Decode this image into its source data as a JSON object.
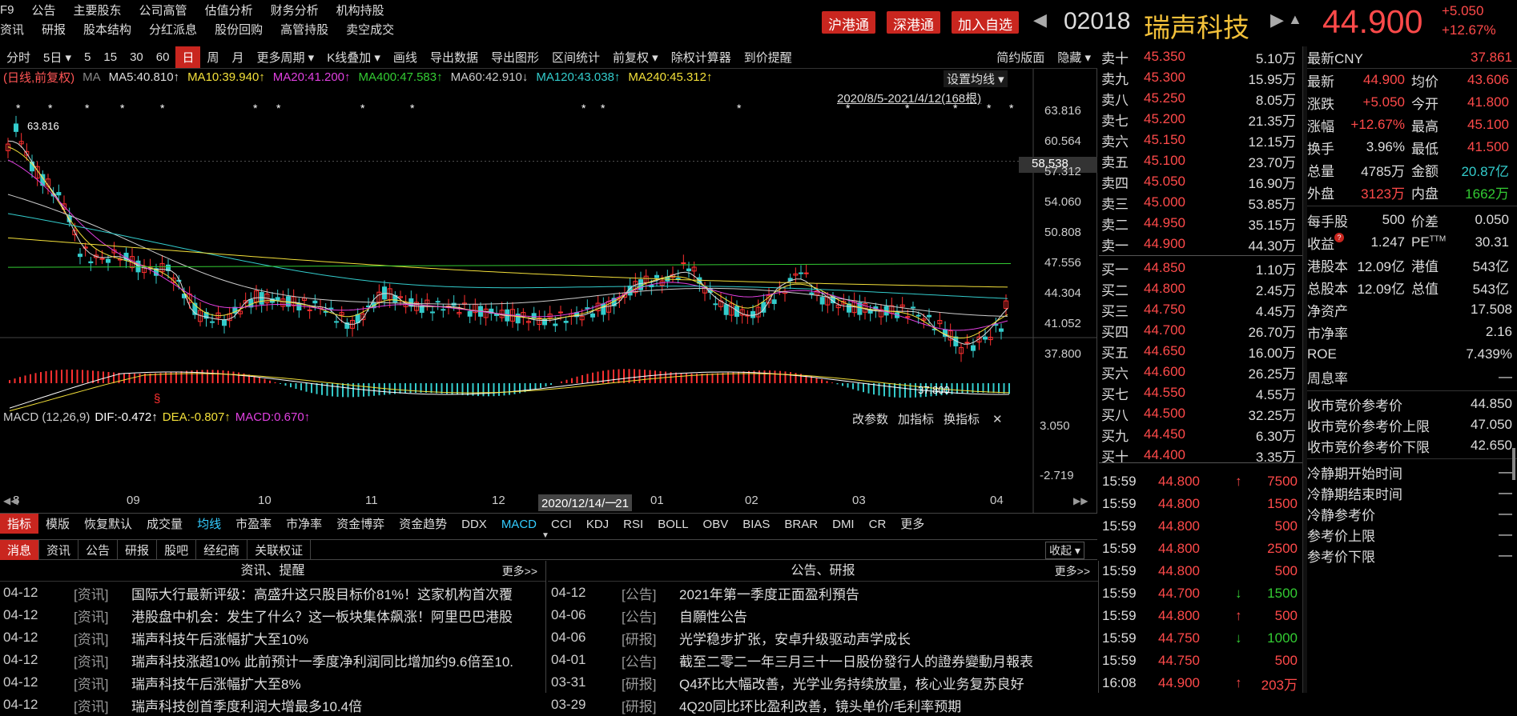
{
  "menu": {
    "row1": [
      "F9",
      "公告",
      "主要股东",
      "公司高管",
      "估值分析",
      "财务分析",
      "机构持股"
    ],
    "row2": [
      "资讯",
      "研报",
      "股本结构",
      "分红派息",
      "股份回购",
      "高管持股",
      "卖空成交"
    ]
  },
  "header": {
    "btn_hk_sh": "沪港通",
    "btn_hk_sz": "深港通",
    "btn_add": "加入自选",
    "code": "02018",
    "name": "瑞声科技",
    "price": "44.900",
    "change": "+5.050",
    "change_pct": "+12.67%"
  },
  "toolbar": {
    "items": [
      "分时",
      "5日 ▾",
      "5",
      "15",
      "30",
      "60",
      "日",
      "周",
      "月",
      "更多周期 ▾",
      "K线叠加 ▾",
      "画线",
      "导出数据",
      "导出图形",
      "区间统计",
      "前复权 ▾",
      "除权计算器",
      "到价提醒"
    ],
    "right": [
      "简约版面",
      "隐藏 ▾"
    ]
  },
  "ma_legend": [
    {
      "text": "(日线,前复权)",
      "color": "#ff5555"
    },
    {
      "text": "MA",
      "color": "#888888"
    },
    {
      "text": "MA5:40.810↑",
      "color": "#dddddd"
    },
    {
      "text": "MA10:39.940↑",
      "color": "#f3e03a"
    },
    {
      "text": "MA20:41.200↑",
      "color": "#e040e0"
    },
    {
      "text": "MA400:47.583↑",
      "color": "#33cc33"
    },
    {
      "text": "MA60:42.910↓",
      "color": "#cccccc"
    },
    {
      "text": "MA120:43.038↑",
      "color": "#33cccc"
    },
    {
      "text": "MA240:45.312↑",
      "color": "#f3e03a"
    }
  ],
  "chart_ctrl": {
    "set_ma": "设置均线 ▾",
    "range": "2020/8/5-2021/4/12(168根)",
    "high_lbl": "63.816",
    "low_lbl": "37.800",
    "cur_price_tag": "58.538",
    "s_mark": "§"
  },
  "price_axis": [
    "63.816",
    "60.564",
    "57.312",
    "54.060",
    "50.808",
    "47.556",
    "44.304",
    "41.052",
    "37.800"
  ],
  "macd": {
    "title": "MACD (12,26,9)",
    "dif": "DIF:-0.472↑",
    "dea": "DEA:-0.807↑",
    "macd": "MACD:0.670↑",
    "btns": [
      "改参数",
      "加指标",
      "换指标"
    ],
    "close": "✕",
    "axis_top": "3.050",
    "axis_bottom": "-2.719"
  },
  "time_axis": {
    "labels": [
      "8",
      "09",
      "10",
      "11",
      "12",
      "01",
      "02",
      "03",
      "04"
    ],
    "cursor": "2020/12/14/一",
    "cursor_suffix": "21"
  },
  "indicator_tabs": [
    "指标",
    "模版",
    "恢复默认",
    "成交量",
    "均线",
    "市盈率",
    "市净率",
    "资金博弈",
    "资金趋势",
    "DDX",
    "MACD",
    "CCI",
    "KDJ",
    "RSI",
    "BOLL",
    "OBV",
    "BIAS",
    "BRAR",
    "DMI",
    "CR",
    "更多"
  ],
  "news_tabs": [
    "消息",
    "资讯",
    "公告",
    "研报",
    "股吧",
    "经纪商",
    "关联权证"
  ],
  "news_collapse": "收起 ▾",
  "news_left": {
    "title": "资讯、提醒",
    "more": "更多>>",
    "rows": [
      {
        "date": "04-12",
        "tag": "[资讯]",
        "text": "国际大行最新评级：高盛升这只股目标价81%！这家机构首次覆"
      },
      {
        "date": "04-12",
        "tag": "[资讯]",
        "text": "港股盘中机会：发生了什么？这一板块集体飙涨！阿里巴巴港股"
      },
      {
        "date": "04-12",
        "tag": "[资讯]",
        "text": "瑞声科技午后涨幅扩大至10%"
      },
      {
        "date": "04-12",
        "tag": "[资讯]",
        "text": "瑞声科技涨超10%  此前预计一季度净利润同比增加约9.6倍至10."
      },
      {
        "date": "04-12",
        "tag": "[资讯]",
        "text": "瑞声科技午后涨幅扩大至8%"
      },
      {
        "date": "04-12",
        "tag": "[资讯]",
        "text": "瑞声科技创首季度利润大增最多10.4倍"
      }
    ]
  },
  "news_right": {
    "title": "公告、研报",
    "more": "更多>>",
    "rows": [
      {
        "date": "04-12",
        "tag": "[公告]",
        "text": "2021年第一季度正面盈利預告"
      },
      {
        "date": "04-06",
        "tag": "[公告]",
        "text": "自願性公告"
      },
      {
        "date": "04-06",
        "tag": "[研报]",
        "text": "光学稳步扩张，安卓升级驱动声学成长"
      },
      {
        "date": "04-01",
        "tag": "[公告]",
        "text": "截至二零二一年三月三十一日股份發行人的證券變動月報表"
      },
      {
        "date": "03-31",
        "tag": "[研报]",
        "text": "Q4环比大幅改善，光学业务持续放量，核心业务复苏良好"
      },
      {
        "date": "03-29",
        "tag": "[研报]",
        "text": "4Q20同比环比盈利改善，镜头单价/毛利率预期"
      }
    ]
  },
  "order_book": {
    "asks": [
      {
        "l": "卖十",
        "p": "45.350",
        "v": "5.10万"
      },
      {
        "l": "卖九",
        "p": "45.300",
        "v": "15.95万"
      },
      {
        "l": "卖八",
        "p": "45.250",
        "v": "8.05万"
      },
      {
        "l": "卖七",
        "p": "45.200",
        "v": "21.35万"
      },
      {
        "l": "卖六",
        "p": "45.150",
        "v": "12.15万"
      },
      {
        "l": "卖五",
        "p": "45.100",
        "v": "23.70万"
      },
      {
        "l": "卖四",
        "p": "45.050",
        "v": "16.90万"
      },
      {
        "l": "卖三",
        "p": "45.000",
        "v": "53.85万"
      },
      {
        "l": "卖二",
        "p": "44.950",
        "v": "35.15万"
      },
      {
        "l": "卖一",
        "p": "44.900",
        "v": "44.30万"
      }
    ],
    "bids": [
      {
        "l": "买一",
        "p": "44.850",
        "v": "1.10万"
      },
      {
        "l": "买二",
        "p": "44.800",
        "v": "2.45万"
      },
      {
        "l": "买三",
        "p": "44.750",
        "v": "4.45万"
      },
      {
        "l": "买四",
        "p": "44.700",
        "v": "26.70万"
      },
      {
        "l": "买五",
        "p": "44.650",
        "v": "16.00万"
      },
      {
        "l": "买六",
        "p": "44.600",
        "v": "26.25万"
      },
      {
        "l": "买七",
        "p": "44.550",
        "v": "4.55万"
      },
      {
        "l": "买八",
        "p": "44.500",
        "v": "32.25万"
      },
      {
        "l": "买九",
        "p": "44.450",
        "v": "6.30万"
      },
      {
        "l": "买十",
        "p": "44.400",
        "v": "3.35万"
      }
    ]
  },
  "trades": [
    {
      "t": "15:59",
      "p": "44.800",
      "a": "↑",
      "v": "7500",
      "c": "#ff4a4a"
    },
    {
      "t": "15:59",
      "p": "44.800",
      "a": "",
      "v": "1500",
      "c": "#ff4a4a"
    },
    {
      "t": "15:59",
      "p": "44.800",
      "a": "",
      "v": "500",
      "c": "#ff4a4a"
    },
    {
      "t": "15:59",
      "p": "44.800",
      "a": "",
      "v": "2500",
      "c": "#ff4a4a"
    },
    {
      "t": "15:59",
      "p": "44.800",
      "a": "",
      "v": "500",
      "c": "#ff4a4a"
    },
    {
      "t": "15:59",
      "p": "44.700",
      "a": "↓",
      "v": "1500",
      "c": "#33cc33"
    },
    {
      "t": "15:59",
      "p": "44.800",
      "a": "↑",
      "v": "500",
      "c": "#ff4a4a"
    },
    {
      "t": "15:59",
      "p": "44.750",
      "a": "↓",
      "v": "1000",
      "c": "#33cc33"
    },
    {
      "t": "15:59",
      "p": "44.750",
      "a": "",
      "v": "500",
      "c": "#ff4a4a"
    },
    {
      "t": "16:08",
      "p": "44.900",
      "a": "↑",
      "v": "203万",
      "c": "#ff4a4a"
    }
  ],
  "stats": {
    "latest_cny_label": "最新CNY",
    "latest_cny": "37.861",
    "pairs": [
      [
        {
          "k": "最新",
          "v": "44.900",
          "c": "#ff4a4a"
        },
        {
          "k": "均价",
          "v": "43.606",
          "c": "#ff4a4a"
        }
      ],
      [
        {
          "k": "涨跌",
          "v": "+5.050",
          "c": "#ff4a4a"
        },
        {
          "k": "今开",
          "v": "41.800",
          "c": "#ff4a4a"
        }
      ],
      [
        {
          "k": "涨幅",
          "v": "+12.67%",
          "c": "#ff4a4a"
        },
        {
          "k": "最高",
          "v": "45.100",
          "c": "#ff4a4a"
        }
      ],
      [
        {
          "k": "换手",
          "v": "3.96%",
          "c": "#dddddd"
        },
        {
          "k": "最低",
          "v": "41.500",
          "c": "#ff4a4a"
        }
      ],
      [
        {
          "k": "总量",
          "v": "4785万",
          "c": "#dddddd"
        },
        {
          "k": "金额",
          "v": "20.87亿",
          "c": "#33cccc"
        }
      ],
      [
        {
          "k": "外盘",
          "v": "3123万",
          "c": "#ff4a4a"
        },
        {
          "k": "内盘",
          "v": "1662万",
          "c": "#33cc33"
        }
      ]
    ],
    "pairs2": [
      [
        {
          "k": "每手股",
          "v": "500"
        },
        {
          "k": "价差",
          "v": "0.050"
        }
      ],
      [
        {
          "k": "收益",
          "v": "1.247"
        },
        {
          "k": "PE",
          "v": "30.31"
        }
      ],
      [
        {
          "k": "港股本",
          "v": "12.09亿"
        },
        {
          "k": "港值",
          "v": "543亿"
        }
      ],
      [
        {
          "k": "总股本",
          "v": "12.09亿"
        },
        {
          "k": "总值",
          "v": "543亿"
        }
      ]
    ],
    "pe_sup": "TTM",
    "singles": [
      {
        "k": "净资产",
        "v": "17.508"
      },
      {
        "k": "市净率",
        "v": "2.16"
      },
      {
        "k": "ROE",
        "v": "7.439%"
      },
      {
        "k": "周息率",
        "v": "—"
      }
    ],
    "auction": [
      {
        "k": "收市竞价参考价",
        "v": "44.850"
      },
      {
        "k": "收市竞价参考价上限",
        "v": "47.050"
      },
      {
        "k": "收市竞价参考价下限",
        "v": "42.650"
      }
    ],
    "cooling": [
      {
        "k": "冷静期开始时间",
        "v": "—"
      },
      {
        "k": "冷静期结束时间",
        "v": "—"
      },
      {
        "k": "冷静参考价",
        "v": "—"
      },
      {
        "k": "参考价上限",
        "v": "—"
      },
      {
        "k": "参考价下限",
        "v": "—"
      }
    ]
  }
}
